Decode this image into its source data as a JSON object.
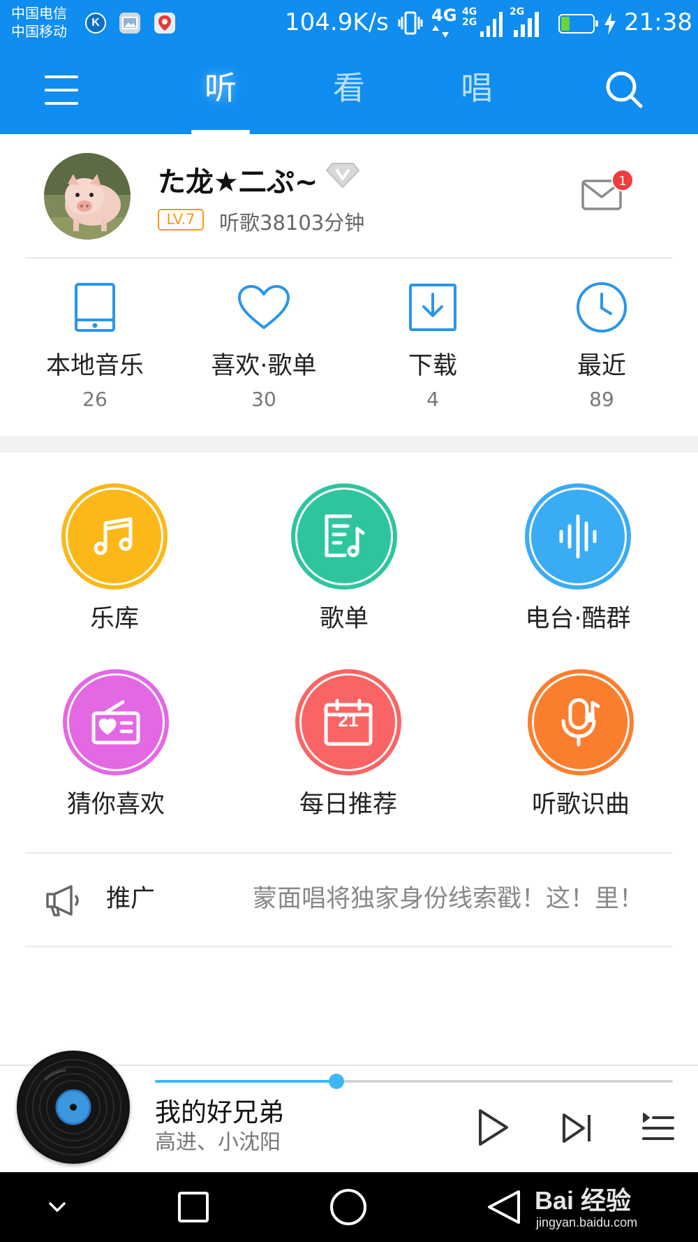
{
  "status_bar": {
    "carrier_1": "中国电信",
    "carrier_2": "中国移动",
    "net_speed": "104.9K/s",
    "network_4g": "4G",
    "network_small_1": "4G",
    "network_small_2": "2G",
    "network_small_3": "2G",
    "battery_level": "34",
    "battery_fraction": 0.34,
    "time": "21:38",
    "notification_icons": [
      "kugou-app-icon",
      "gallery-app-icon",
      "baidu-map-app-icon"
    ]
  },
  "header": {
    "menu_icon": "hamburger-menu-icon",
    "tabs": [
      {
        "label": "听",
        "active": true
      },
      {
        "label": "看",
        "active": false
      },
      {
        "label": "唱",
        "active": false
      }
    ],
    "search_icon": "search-icon"
  },
  "profile": {
    "username": "た龙★二ぷ~",
    "vip_icon": "vip-diamond-icon",
    "level": "LV.7",
    "listen_time": "听歌38103分钟",
    "mail_icon": "mail-icon",
    "unread_count": "1"
  },
  "quick_stats": [
    {
      "label": "本地音乐",
      "count": "26",
      "icon": "tablet-icon"
    },
    {
      "label": "喜欢·歌单",
      "count": "30",
      "icon": "heart-icon"
    },
    {
      "label": "下载",
      "count": "4",
      "icon": "download-icon"
    },
    {
      "label": "最近",
      "count": "89",
      "icon": "clock-icon"
    }
  ],
  "features": [
    {
      "label": "乐库",
      "icon": "music-note-icon",
      "color": "#fbb818"
    },
    {
      "label": "歌单",
      "icon": "playlist-icon",
      "color": "#2ec59e"
    },
    {
      "label": "电台·酷群",
      "icon": "soundwave-icon",
      "color": "#3aabf5"
    },
    {
      "label": "猜你喜欢",
      "icon": "radio-heart-icon",
      "color": "#e467e4"
    },
    {
      "label": "每日推荐",
      "icon": "calendar-icon",
      "calendar_day": "21",
      "color": "#fb6464"
    },
    {
      "label": "听歌识曲",
      "icon": "mic-music-icon",
      "color": "#fb7e2e"
    }
  ],
  "promo": {
    "icon": "megaphone-icon",
    "label": "推广",
    "text": "蒙面唱将独家身份线索戳！这！里！"
  },
  "player": {
    "title": "我的好兄弟",
    "artist": "高进、小沈阳",
    "progress": 0.35,
    "accent": "#3fb6f5",
    "icons": [
      "vinyl-disc-icon",
      "play-icon",
      "next-icon",
      "playlist-queue-icon"
    ]
  },
  "nav_bar": {
    "icons": [
      "collapse-down-icon",
      "recents-square-icon",
      "home-circle-icon",
      "back-triangle-icon"
    ]
  },
  "watermark": {
    "top": "Bai 经验",
    "bottom": "jingyan.baidu.com"
  },
  "colors": {
    "primary": "#0f8df0",
    "icon_blue": "#2a95ea",
    "level_orange": "#f39a1c",
    "badge_red": "#f03c3c"
  }
}
